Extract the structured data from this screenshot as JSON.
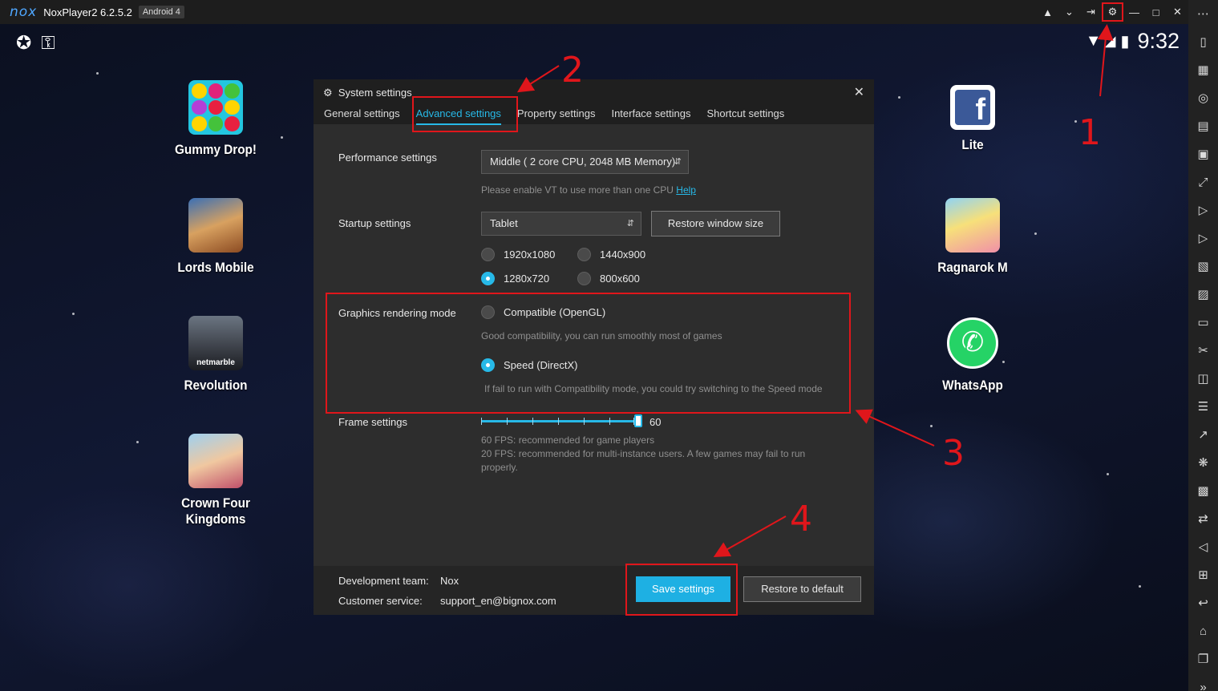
{
  "titlebar": {
    "logo": "nox",
    "app_name": "NoxPlayer2 6.2.5.2",
    "android_badge": "Android 4",
    "icons": [
      "hat-icon",
      "chevron-down-icon",
      "pin-icon",
      "gear-icon",
      "minimize-icon",
      "maximize-icon",
      "close-icon"
    ]
  },
  "statusbar": {
    "time": "9:32"
  },
  "apps": [
    {
      "label": "Gummy Drop!"
    },
    {
      "label": "Lords Mobile"
    },
    {
      "label": "Revolution",
      "sublabel": "netmarble"
    },
    {
      "label": "Crown Four Kingdoms"
    },
    {
      "label": "Lite"
    },
    {
      "label": "Ragnarok M"
    },
    {
      "label": "WhatsApp"
    }
  ],
  "dialog": {
    "title": "System settings",
    "tabs": [
      "General settings",
      "Advanced settings",
      "Property settings",
      "Interface settings",
      "Shortcut settings"
    ],
    "active_tab": "Advanced settings",
    "performance": {
      "label": "Performance settings",
      "value": "Middle ( 2 core CPU, 2048 MB Memory)",
      "hint": "Please enable VT to use more than one CPU",
      "hint_link": "Help"
    },
    "startup": {
      "label": "Startup settings",
      "value": "Tablet",
      "restore_button": "Restore window size",
      "resolutions": [
        {
          "label": "1920x1080",
          "selected": false
        },
        {
          "label": "1440x900",
          "selected": false
        },
        {
          "label": "1280x720",
          "selected": true
        },
        {
          "label": "800x600",
          "selected": false
        }
      ]
    },
    "graphics": {
      "label": "Graphics rendering mode",
      "option1": "Compatible (OpenGL)",
      "option1_hint": "Good compatibility, you can run smoothly most of games",
      "option2": "Speed (DirectX)",
      "option2_hint": "If fail to run with Compatibility mode, you could try switching to the Speed mode",
      "selected": "Speed (DirectX)"
    },
    "frame": {
      "label": "Frame settings",
      "value": "60",
      "hint1": "60 FPS: recommended for game players",
      "hint2": "20 FPS: recommended for multi-instance users. A few games may fail to run properly."
    },
    "footer": {
      "dev_label": "Development team:",
      "dev_value": "Nox",
      "cs_label": "Customer service:",
      "cs_value": "support_en@bignox.com",
      "save_button": "Save settings",
      "restore_default_button": "Restore to default"
    }
  },
  "annotations": {
    "colors": {
      "annotation": "#e0161b",
      "accent": "#27b9e8"
    },
    "numbers": [
      "1",
      "2",
      "3",
      "4"
    ]
  }
}
